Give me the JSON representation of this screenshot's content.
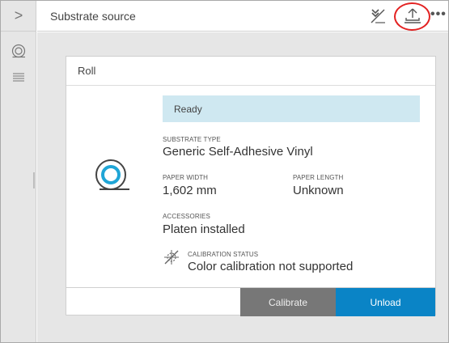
{
  "header": {
    "title": "Substrate source",
    "more_label": "•••"
  },
  "sidebar": {
    "expand_glyph": ">"
  },
  "card": {
    "title": "Roll",
    "status": "Ready",
    "substrate_type_label": "SUBSTRATE TYPE",
    "substrate_type_value": "Generic Self-Adhesive Vinyl",
    "paper_width_label": "PAPER WIDTH",
    "paper_width_value": "1,602 mm",
    "paper_length_label": "PAPER LENGTH",
    "paper_length_value": "Unknown",
    "accessories_label": "ACCESSORIES",
    "accessories_value": "Platen installed",
    "calibration_status_label": "CALIBRATION STATUS",
    "calibration_status_value": "Color calibration not supported"
  },
  "actions": {
    "calibrate_label": "Calibrate",
    "unload_label": "Unload"
  },
  "colors": {
    "accent": "#0a84c6",
    "status_bg": "#cfe8f1",
    "highlight": "#e32222",
    "roll_ring": "#1fa5d6"
  },
  "icons": {
    "expand": "chevron-right-icon",
    "roll_nav": "roll-icon",
    "sheet_nav": "sheet-stack-icon",
    "edit": "edit-substrate-icon",
    "unload": "unload-icon",
    "more": "more-options-icon",
    "roll": "roll-icon",
    "calibration": "calibration-not-supported-icon"
  }
}
